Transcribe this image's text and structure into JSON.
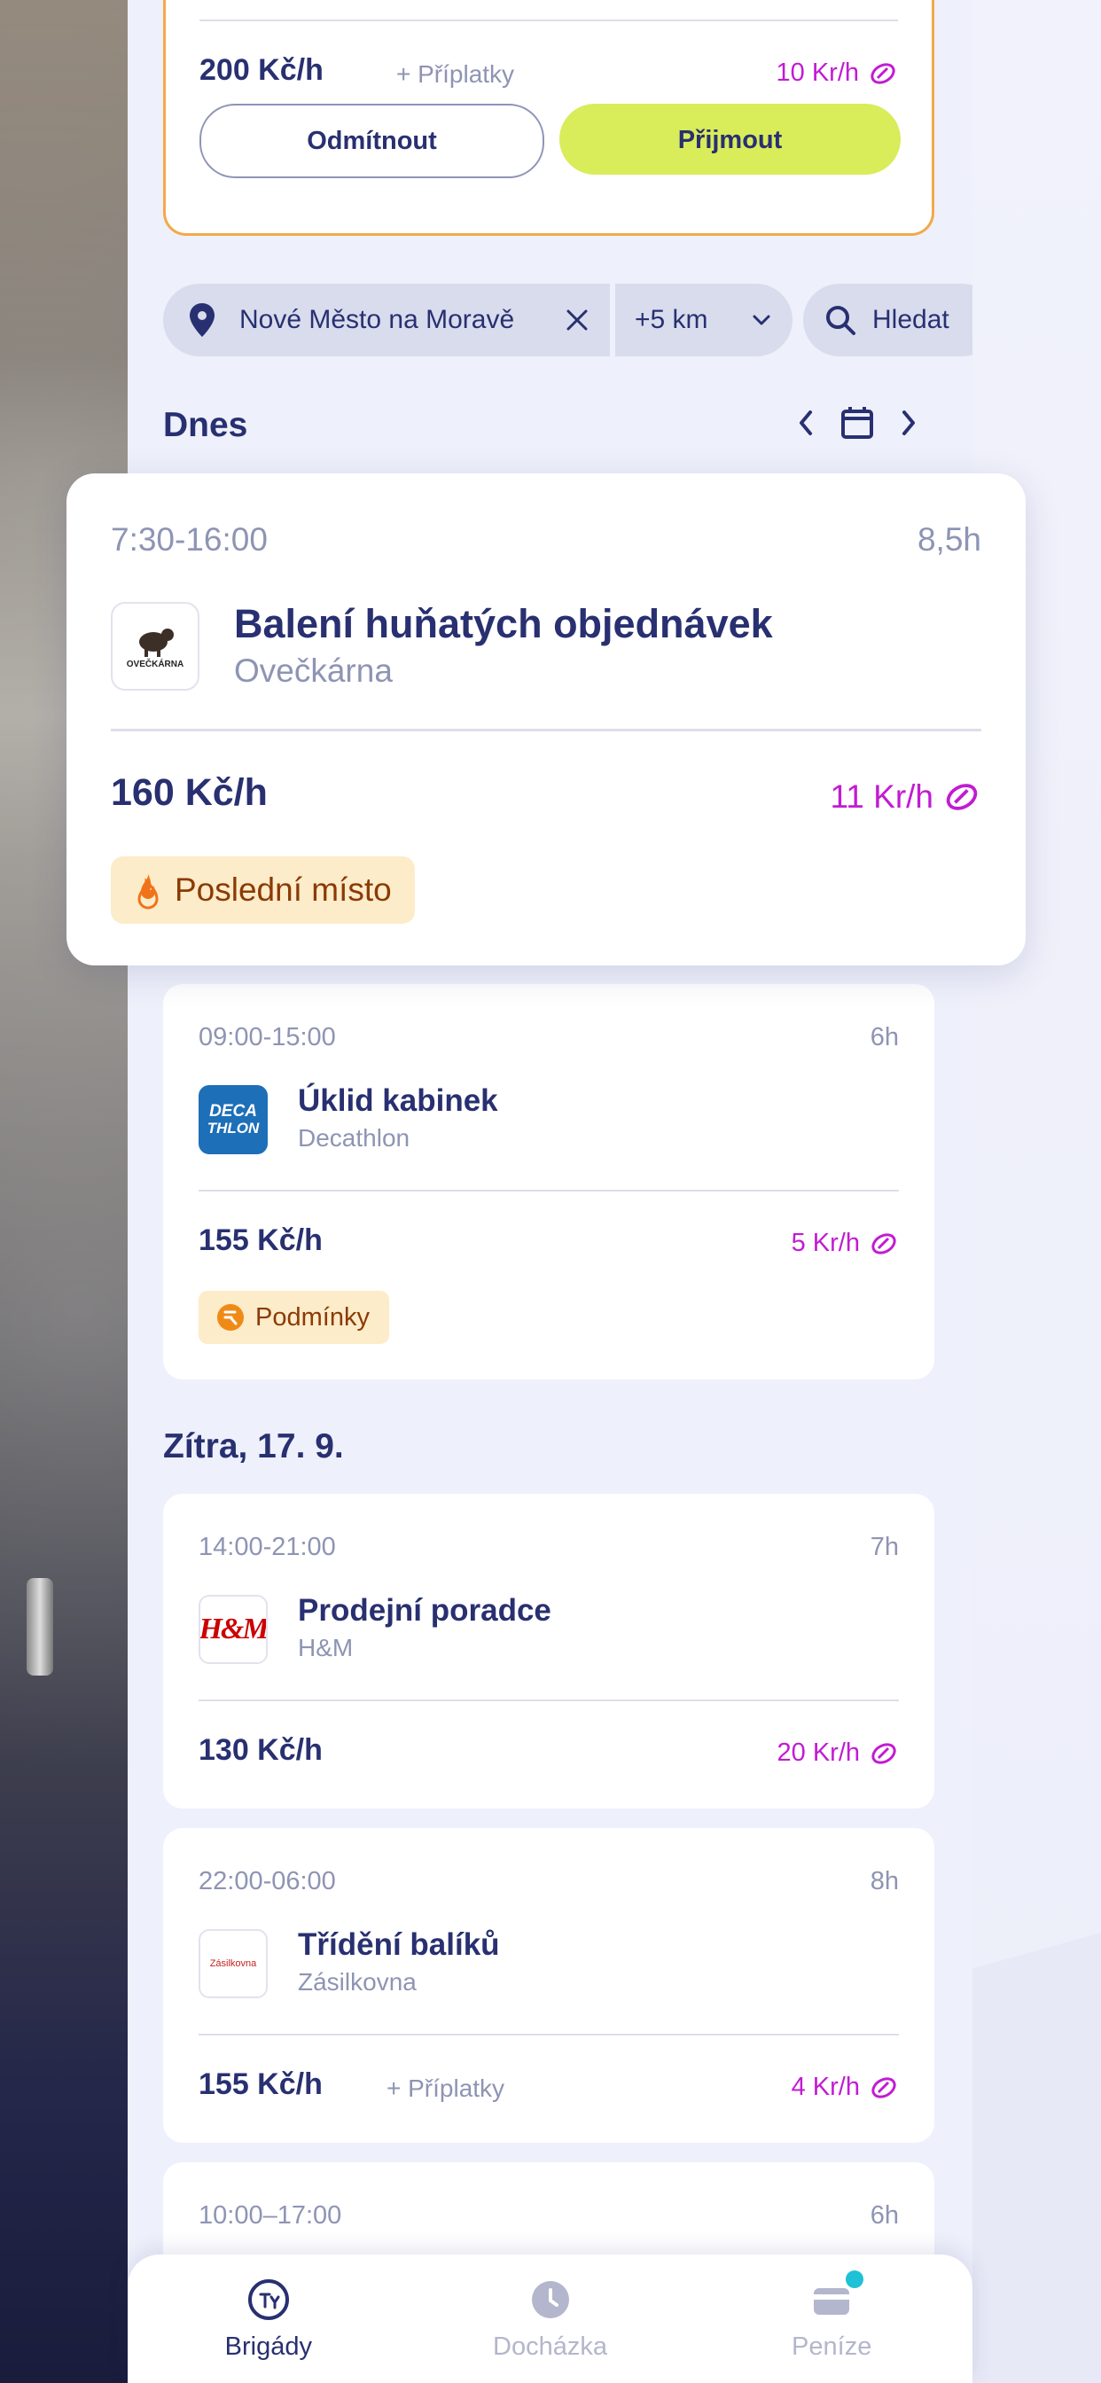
{
  "colors": {
    "brand": "#283071",
    "accent_lime": "#d9ec5a",
    "credit": "#c21bd3",
    "offer_border": "#f2a94a",
    "badge_bg": "#fcecc9"
  },
  "offer": {
    "price": "200 Kč/h",
    "extra": "+ Příplatky",
    "credit": "10 Kr/h",
    "reject_label": "Odmítnout",
    "accept_label": "Přijmout"
  },
  "filters": {
    "location": "Nové Město na Moravě",
    "radius": "+5 km",
    "search_placeholder": "Hledat"
  },
  "today": {
    "title": "Dnes",
    "highlight": {
      "time": "7:30-16:00",
      "duration": "8,5h",
      "title": "Balení huňatých objednávek",
      "company": "Ovečkárna",
      "logo_text": "OVEČKÁRNA",
      "price": "160 Kč/h",
      "credit": "11 Kr/h",
      "badge": "Poslední místo"
    },
    "jobs": [
      {
        "time": "09:00-15:00",
        "duration": "6h",
        "title": "Úklid kabinek",
        "company": "Decathlon",
        "logo_text_1": "DECA",
        "logo_text_2": "THLON",
        "price": "155 Kč/h",
        "credit": "5 Kr/h",
        "badge": "Podmínky"
      }
    ]
  },
  "tomorrow": {
    "title": "Zítra, 17. 9.",
    "jobs": [
      {
        "time": "14:00-21:00",
        "duration": "7h",
        "title": "Prodejní poradce",
        "company": "H&M",
        "logo_text": "H&M",
        "price": "130 Kč/h",
        "credit": "20 Kr/h"
      },
      {
        "time": "22:00-06:00",
        "duration": "8h",
        "title": "Třídění balíků",
        "company": "Zásilkovna",
        "logo_text": "Zásilkovna",
        "price": "155 Kč/h",
        "extra": "+ Příplatky",
        "credit": "4 Kr/h"
      },
      {
        "time": "10:00–17:00",
        "duration": "6h"
      }
    ]
  },
  "bottom_nav": [
    {
      "label": "Brigády",
      "icon": "brigady-icon",
      "active": true
    },
    {
      "label": "Docházka",
      "icon": "clock-icon",
      "active": false
    },
    {
      "label": "Peníze",
      "icon": "wallet-icon",
      "active": false
    }
  ]
}
